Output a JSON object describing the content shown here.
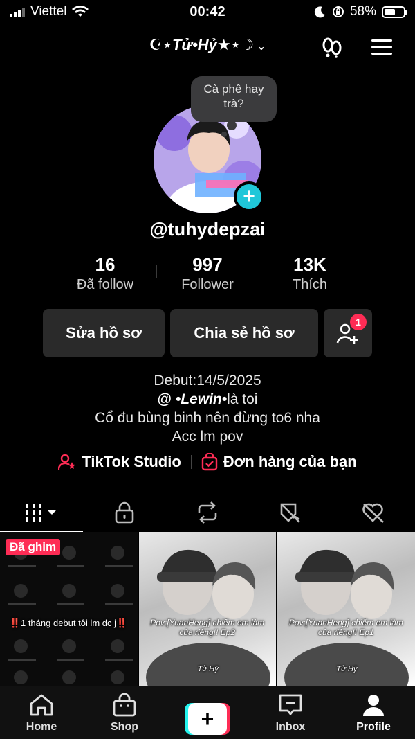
{
  "status_bar": {
    "carrier": "Viettel",
    "time": "00:42",
    "battery": "58%",
    "battery_level": 0.58
  },
  "header": {
    "account_name": "☪︎⋆Tử•Hỷ★⋆☽",
    "account_switch_icon": "chevron-down-icon",
    "left_icon": "footprints-icon",
    "menu_icon": "hamburger-menu-icon"
  },
  "profile": {
    "note": "Cà phê hay trà?",
    "username": "@tuhydepzai",
    "stats": [
      {
        "value": "16",
        "label": "Đã follow"
      },
      {
        "value": "997",
        "label": "Follower"
      },
      {
        "value": "13K",
        "label": "Thích"
      }
    ],
    "buttons": {
      "edit": "Sửa hồ sơ",
      "share": "Chia sẻ hồ sơ",
      "friend_badge": "1"
    },
    "bio": {
      "line1": "Debut:14/5/2025",
      "mention_prefix": "@",
      "mention_name": "•Lewin•",
      "line2_suffix": "là toi",
      "line3": "Cổ đu bùng binh nên đừng to6 nha",
      "line4": "Acc lm pov"
    },
    "links": {
      "studio": "TikTok Studio",
      "orders": "Đơn hàng của bạn"
    }
  },
  "tabs": [
    {
      "icon": "grid-icon",
      "active": true
    },
    {
      "icon": "lock-icon",
      "active": false
    },
    {
      "icon": "repost-icon",
      "active": false
    },
    {
      "icon": "favorites-icon",
      "active": false
    },
    {
      "icon": "liked-icon",
      "active": false
    }
  ],
  "videos": [
    {
      "pinned_label": "Đã ghim",
      "caption": "‼️1 tháng debut tôi lm dc j‼️"
    },
    {
      "caption": "Pov:[YuanHeng] chiếm em làm của riêng!! Ep2",
      "watermark": "Tử Hỷ"
    },
    {
      "caption": "Pov:[YuanHeng] chiếm em làm của riêng!! Ep1",
      "watermark": "Tử Hỷ"
    }
  ],
  "bottom_nav": {
    "home": "Home",
    "shop": "Shop",
    "create": "+",
    "inbox": "Inbox",
    "profile": "Profile"
  },
  "colors": {
    "accent": "#fe2c55",
    "cyan": "#25f4ee",
    "add_avatar": "#20c7d9",
    "background": "#000000"
  }
}
